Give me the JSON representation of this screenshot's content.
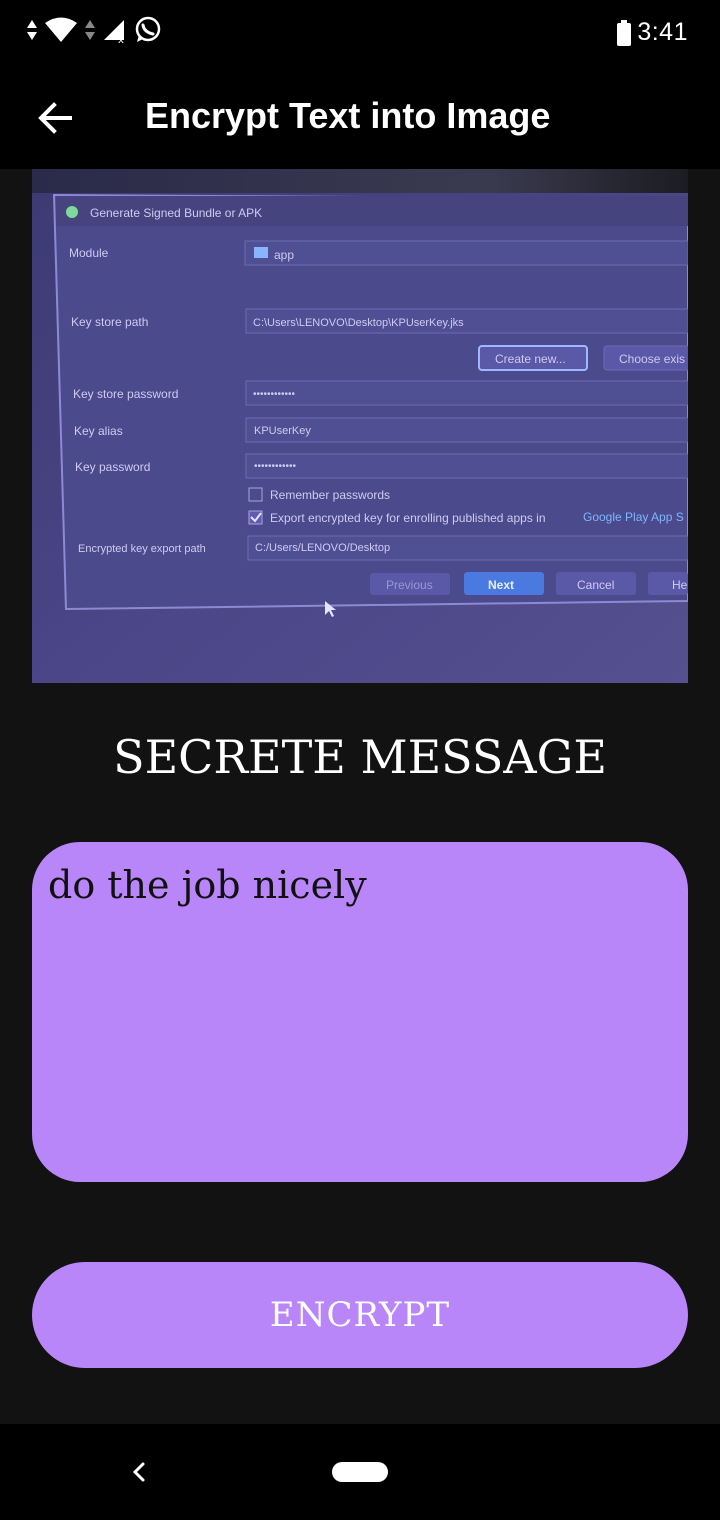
{
  "status_bar": {
    "time": "3:41",
    "icons": [
      "data-transfer-icon",
      "wifi-icon",
      "data-transfer-icon",
      "signal-icon",
      "whatsapp-icon",
      "battery-icon"
    ]
  },
  "app_bar": {
    "title": "Encrypt Text into Image",
    "back_icon": "arrow-left-icon"
  },
  "image": {
    "screenshot_dialog": {
      "title": "Generate Signed Bundle or APK",
      "module_label": "Module",
      "module_value": "app",
      "key_store_path_label": "Key store path",
      "key_store_path_value": "C:\\Users\\LENOVO\\Desktop\\KPUserKey.jks",
      "create_new": "Create new...",
      "choose_existing": "Choose exis",
      "key_store_password_label": "Key store password",
      "key_store_password_value": "••••••••••••",
      "key_alias_label": "Key alias",
      "key_alias_value": "KPUserKey",
      "key_password_label": "Key password",
      "key_password_value": "••••••••••••",
      "remember_passwords": "Remember passwords",
      "export_encrypted": "Export encrypted key for enrolling published apps in",
      "google_play": "Google Play App S",
      "export_path_label": "Encrypted key export path",
      "export_path_value": "C:/Users/LENOVO/Desktop",
      "btn_previous": "Previous",
      "btn_next": "Next",
      "btn_cancel": "Cancel",
      "btn_help": "He"
    }
  },
  "section": {
    "heading": "SECRETE MESSAGE"
  },
  "message": {
    "value": "do the job nicely"
  },
  "actions": {
    "encrypt_label": "ENCRYPT"
  },
  "nav_bar": {
    "back_icon": "chevron-left-icon",
    "home_icon": "home-pill-icon"
  },
  "colors": {
    "accent": "#b886f8",
    "background": "#121212",
    "bars": "#000000"
  }
}
